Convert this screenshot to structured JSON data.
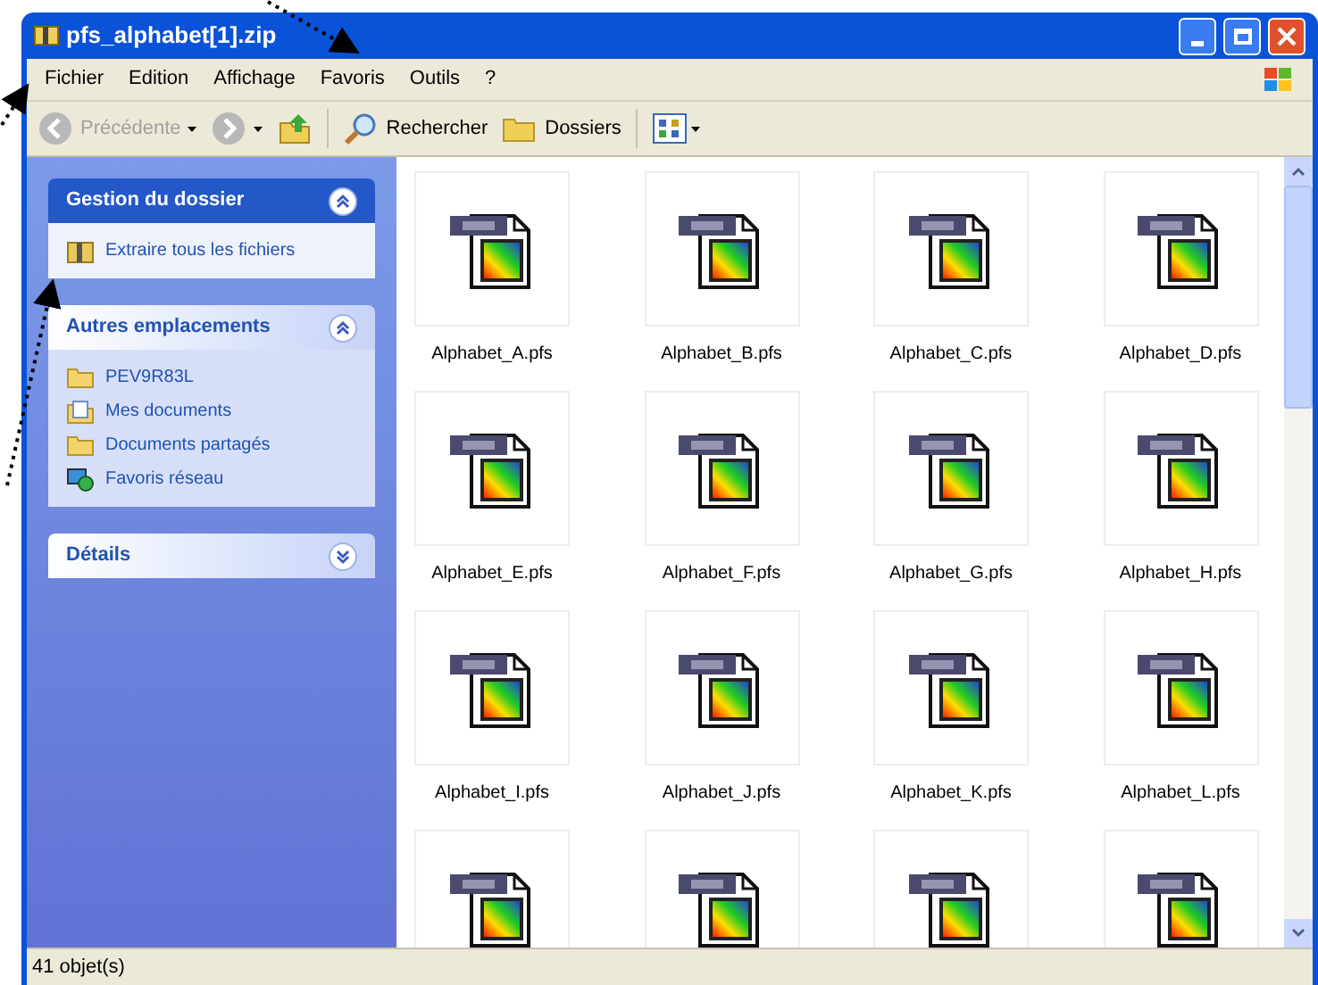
{
  "window": {
    "title": "pfs_alphabet[1].zip"
  },
  "menu": [
    "Fichier",
    "Edition",
    "Affichage",
    "Favoris",
    "Outils",
    "?"
  ],
  "toolbar": {
    "back": {
      "label": "Précédente",
      "disabled": true
    },
    "forward": {
      "disabled": true
    },
    "search": "Rechercher",
    "folders": "Dossiers"
  },
  "sidebar": {
    "panels": [
      {
        "title": "Gestion du dossier",
        "expanded": true,
        "items": [
          {
            "label": "Extraire tous les fichiers",
            "kind": "extract"
          }
        ]
      },
      {
        "title": "Autres emplacements",
        "expanded": true,
        "items": [
          {
            "label": "PEV9R83L",
            "kind": "folder"
          },
          {
            "label": "Mes documents",
            "kind": "documents"
          },
          {
            "label": "Documents partagés",
            "kind": "folder"
          },
          {
            "label": "Favoris réseau",
            "kind": "network"
          }
        ]
      },
      {
        "title": "Détails",
        "expanded": false
      }
    ]
  },
  "files": [
    {
      "kind": "pfs",
      "name": "Alphabet_A.pfs"
    },
    {
      "kind": "pfs",
      "name": "Alphabet_B.pfs"
    },
    {
      "kind": "pfs",
      "name": "Alphabet_C.pfs"
    },
    {
      "kind": "pfs",
      "name": "Alphabet_D.pfs"
    },
    {
      "kind": "pfs",
      "name": "Alphabet_E.pfs"
    },
    {
      "kind": "pfs",
      "name": "Alphabet_F.pfs"
    },
    {
      "kind": "pfs",
      "name": "Alphabet_G.pfs"
    },
    {
      "kind": "pfs",
      "name": "Alphabet_H.pfs"
    },
    {
      "kind": "pfs",
      "name": "Alphabet_I.pfs"
    },
    {
      "kind": "pfs",
      "name": "Alphabet_J.pfs"
    },
    {
      "kind": "pfs",
      "name": "Alphabet_K.pfs"
    },
    {
      "kind": "pfs",
      "name": "Alphabet_L.pfs"
    },
    {
      "kind": "pfs"
    },
    {
      "kind": "pfs"
    },
    {
      "kind": "pfs"
    },
    {
      "kind": "pfs"
    }
  ],
  "status_bar": "41 objet(s)"
}
